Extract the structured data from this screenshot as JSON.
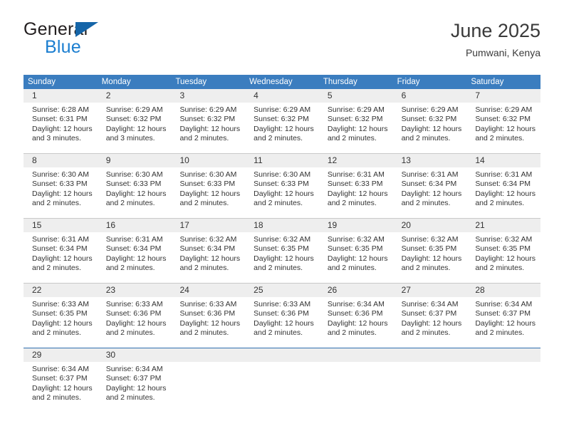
{
  "brand": {
    "name_top": "General",
    "name_bottom": "Blue",
    "triangle_color": "#1565a8",
    "blue_text_color": "#1b7ed0"
  },
  "header": {
    "title": "June 2025",
    "subtitle": "Pumwani, Kenya"
  },
  "calendar": {
    "header_bg": "#3b7dbf",
    "daynum_band_bg": "#eeeeee",
    "weekdays": [
      "Sunday",
      "Monday",
      "Tuesday",
      "Wednesday",
      "Thursday",
      "Friday",
      "Saturday"
    ],
    "weeks": [
      [
        {
          "day": "1",
          "sunrise": "Sunrise: 6:28 AM",
          "sunset": "Sunset: 6:31 PM",
          "daylight_1": "Daylight: 12 hours",
          "daylight_2": "and 3 minutes."
        },
        {
          "day": "2",
          "sunrise": "Sunrise: 6:29 AM",
          "sunset": "Sunset: 6:32 PM",
          "daylight_1": "Daylight: 12 hours",
          "daylight_2": "and 3 minutes."
        },
        {
          "day": "3",
          "sunrise": "Sunrise: 6:29 AM",
          "sunset": "Sunset: 6:32 PM",
          "daylight_1": "Daylight: 12 hours",
          "daylight_2": "and 2 minutes."
        },
        {
          "day": "4",
          "sunrise": "Sunrise: 6:29 AM",
          "sunset": "Sunset: 6:32 PM",
          "daylight_1": "Daylight: 12 hours",
          "daylight_2": "and 2 minutes."
        },
        {
          "day": "5",
          "sunrise": "Sunrise: 6:29 AM",
          "sunset": "Sunset: 6:32 PM",
          "daylight_1": "Daylight: 12 hours",
          "daylight_2": "and 2 minutes."
        },
        {
          "day": "6",
          "sunrise": "Sunrise: 6:29 AM",
          "sunset": "Sunset: 6:32 PM",
          "daylight_1": "Daylight: 12 hours",
          "daylight_2": "and 2 minutes."
        },
        {
          "day": "7",
          "sunrise": "Sunrise: 6:29 AM",
          "sunset": "Sunset: 6:32 PM",
          "daylight_1": "Daylight: 12 hours",
          "daylight_2": "and 2 minutes."
        }
      ],
      [
        {
          "day": "8",
          "sunrise": "Sunrise: 6:30 AM",
          "sunset": "Sunset: 6:33 PM",
          "daylight_1": "Daylight: 12 hours",
          "daylight_2": "and 2 minutes."
        },
        {
          "day": "9",
          "sunrise": "Sunrise: 6:30 AM",
          "sunset": "Sunset: 6:33 PM",
          "daylight_1": "Daylight: 12 hours",
          "daylight_2": "and 2 minutes."
        },
        {
          "day": "10",
          "sunrise": "Sunrise: 6:30 AM",
          "sunset": "Sunset: 6:33 PM",
          "daylight_1": "Daylight: 12 hours",
          "daylight_2": "and 2 minutes."
        },
        {
          "day": "11",
          "sunrise": "Sunrise: 6:30 AM",
          "sunset": "Sunset: 6:33 PM",
          "daylight_1": "Daylight: 12 hours",
          "daylight_2": "and 2 minutes."
        },
        {
          "day": "12",
          "sunrise": "Sunrise: 6:31 AM",
          "sunset": "Sunset: 6:33 PM",
          "daylight_1": "Daylight: 12 hours",
          "daylight_2": "and 2 minutes."
        },
        {
          "day": "13",
          "sunrise": "Sunrise: 6:31 AM",
          "sunset": "Sunset: 6:34 PM",
          "daylight_1": "Daylight: 12 hours",
          "daylight_2": "and 2 minutes."
        },
        {
          "day": "14",
          "sunrise": "Sunrise: 6:31 AM",
          "sunset": "Sunset: 6:34 PM",
          "daylight_1": "Daylight: 12 hours",
          "daylight_2": "and 2 minutes."
        }
      ],
      [
        {
          "day": "15",
          "sunrise": "Sunrise: 6:31 AM",
          "sunset": "Sunset: 6:34 PM",
          "daylight_1": "Daylight: 12 hours",
          "daylight_2": "and 2 minutes."
        },
        {
          "day": "16",
          "sunrise": "Sunrise: 6:31 AM",
          "sunset": "Sunset: 6:34 PM",
          "daylight_1": "Daylight: 12 hours",
          "daylight_2": "and 2 minutes."
        },
        {
          "day": "17",
          "sunrise": "Sunrise: 6:32 AM",
          "sunset": "Sunset: 6:34 PM",
          "daylight_1": "Daylight: 12 hours",
          "daylight_2": "and 2 minutes."
        },
        {
          "day": "18",
          "sunrise": "Sunrise: 6:32 AM",
          "sunset": "Sunset: 6:35 PM",
          "daylight_1": "Daylight: 12 hours",
          "daylight_2": "and 2 minutes."
        },
        {
          "day": "19",
          "sunrise": "Sunrise: 6:32 AM",
          "sunset": "Sunset: 6:35 PM",
          "daylight_1": "Daylight: 12 hours",
          "daylight_2": "and 2 minutes."
        },
        {
          "day": "20",
          "sunrise": "Sunrise: 6:32 AM",
          "sunset": "Sunset: 6:35 PM",
          "daylight_1": "Daylight: 12 hours",
          "daylight_2": "and 2 minutes."
        },
        {
          "day": "21",
          "sunrise": "Sunrise: 6:32 AM",
          "sunset": "Sunset: 6:35 PM",
          "daylight_1": "Daylight: 12 hours",
          "daylight_2": "and 2 minutes."
        }
      ],
      [
        {
          "day": "22",
          "sunrise": "Sunrise: 6:33 AM",
          "sunset": "Sunset: 6:35 PM",
          "daylight_1": "Daylight: 12 hours",
          "daylight_2": "and 2 minutes."
        },
        {
          "day": "23",
          "sunrise": "Sunrise: 6:33 AM",
          "sunset": "Sunset: 6:36 PM",
          "daylight_1": "Daylight: 12 hours",
          "daylight_2": "and 2 minutes."
        },
        {
          "day": "24",
          "sunrise": "Sunrise: 6:33 AM",
          "sunset": "Sunset: 6:36 PM",
          "daylight_1": "Daylight: 12 hours",
          "daylight_2": "and 2 minutes."
        },
        {
          "day": "25",
          "sunrise": "Sunrise: 6:33 AM",
          "sunset": "Sunset: 6:36 PM",
          "daylight_1": "Daylight: 12 hours",
          "daylight_2": "and 2 minutes."
        },
        {
          "day": "26",
          "sunrise": "Sunrise: 6:34 AM",
          "sunset": "Sunset: 6:36 PM",
          "daylight_1": "Daylight: 12 hours",
          "daylight_2": "and 2 minutes."
        },
        {
          "day": "27",
          "sunrise": "Sunrise: 6:34 AM",
          "sunset": "Sunset: 6:37 PM",
          "daylight_1": "Daylight: 12 hours",
          "daylight_2": "and 2 minutes."
        },
        {
          "day": "28",
          "sunrise": "Sunrise: 6:34 AM",
          "sunset": "Sunset: 6:37 PM",
          "daylight_1": "Daylight: 12 hours",
          "daylight_2": "and 2 minutes."
        }
      ],
      [
        {
          "day": "29",
          "sunrise": "Sunrise: 6:34 AM",
          "sunset": "Sunset: 6:37 PM",
          "daylight_1": "Daylight: 12 hours",
          "daylight_2": "and 2 minutes."
        },
        {
          "day": "30",
          "sunrise": "Sunrise: 6:34 AM",
          "sunset": "Sunset: 6:37 PM",
          "daylight_1": "Daylight: 12 hours",
          "daylight_2": "and 2 minutes."
        },
        {
          "day": "",
          "sunrise": "",
          "sunset": "",
          "daylight_1": "",
          "daylight_2": ""
        },
        {
          "day": "",
          "sunrise": "",
          "sunset": "",
          "daylight_1": "",
          "daylight_2": ""
        },
        {
          "day": "",
          "sunrise": "",
          "sunset": "",
          "daylight_1": "",
          "daylight_2": ""
        },
        {
          "day": "",
          "sunrise": "",
          "sunset": "",
          "daylight_1": "",
          "daylight_2": ""
        },
        {
          "day": "",
          "sunrise": "",
          "sunset": "",
          "daylight_1": "",
          "daylight_2": ""
        }
      ]
    ]
  }
}
